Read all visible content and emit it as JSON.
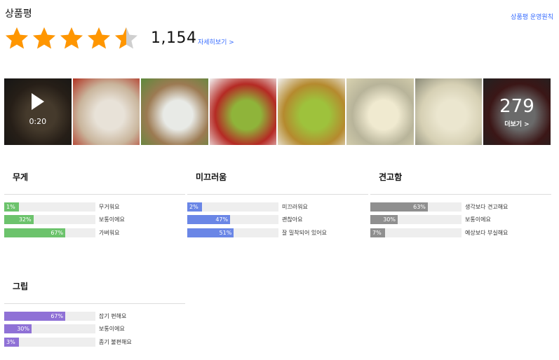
{
  "header": {
    "title": "상품평",
    "policy_link": "상품평 운영원칙"
  },
  "rating": {
    "stars": 4.5,
    "star_color": "#ff9600",
    "star_empty_color": "#cfcfcf",
    "count": "1,154",
    "detail_link": "자세히보기 >"
  },
  "gallery": {
    "video_duration": "0:20",
    "more_count": "279",
    "more_label": "더보기 >",
    "thumbnails": [
      {
        "kind": "video",
        "colors": [
          "#3b2f24",
          "#6b5a44",
          "#222"
        ]
      },
      {
        "kind": "photo",
        "colors": [
          "#c9b59c",
          "#e8e2d8",
          "#b03020"
        ]
      },
      {
        "kind": "photo",
        "colors": [
          "#9c7a52",
          "#e8eae6",
          "#5d8a3c"
        ]
      },
      {
        "kind": "photo",
        "colors": [
          "#b52a24",
          "#8fb43a",
          "#f2f2f2"
        ]
      },
      {
        "kind": "photo",
        "colors": [
          "#b58a2e",
          "#9ec23c",
          "#f0f0f0"
        ]
      },
      {
        "kind": "photo",
        "colors": [
          "#b8b49a",
          "#f0ead0",
          "#d8d2b0"
        ]
      },
      {
        "kind": "photo",
        "colors": [
          "#d6d0b4",
          "#ebe6cf",
          "#8a8a78"
        ]
      },
      {
        "kind": "more",
        "colors": [
          "#6b1a1a",
          "#d3d3d3",
          "#333"
        ]
      }
    ]
  },
  "groups": [
    {
      "title": "무게",
      "color": "#6cc36c",
      "rows": [
        {
          "pct": 1,
          "pct_label": "1%",
          "label": "무거워요"
        },
        {
          "pct": 32,
          "pct_label": "32%",
          "label": "보통이에요"
        },
        {
          "pct": 67,
          "pct_label": "67%",
          "label": "가벼워요"
        }
      ]
    },
    {
      "title": "미끄러움",
      "color": "#6a86e6",
      "rows": [
        {
          "pct": 2,
          "pct_label": "2%",
          "label": "미끄러워요"
        },
        {
          "pct": 47,
          "pct_label": "47%",
          "label": "괜찮아요"
        },
        {
          "pct": 51,
          "pct_label": "51%",
          "label": "잘 밀착되어 있어요"
        }
      ]
    },
    {
      "title": "견고함",
      "color": "#8f8f8f",
      "rows": [
        {
          "pct": 63,
          "pct_label": "63%",
          "label": "생각보다 견고해요"
        },
        {
          "pct": 30,
          "pct_label": "30%",
          "label": "보통이에요"
        },
        {
          "pct": 7,
          "pct_label": "7%",
          "label": "예상보다 부실해요"
        }
      ]
    },
    {
      "title": "그립",
      "color": "#8f71d6",
      "rows": [
        {
          "pct": 67,
          "pct_label": "67%",
          "label": "잡기 편해요"
        },
        {
          "pct": 30,
          "pct_label": "30%",
          "label": "보통이에요"
        },
        {
          "pct": 3,
          "pct_label": "3%",
          "label": "좀기 불편해요"
        }
      ]
    }
  ]
}
